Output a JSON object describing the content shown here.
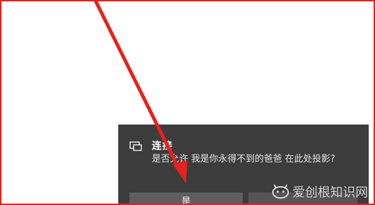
{
  "toast": {
    "title": "连接",
    "message": "是否允许 我是你永得不到的爸爸 在此处投影?",
    "icon": "project-screen-icon",
    "buttons": {
      "yes_label": "是",
      "no_label": ""
    },
    "background_color": "#3c3c3c"
  },
  "annotation": {
    "arrow_color": "#e8201e",
    "frame_color": "#e8201e"
  },
  "watermark": {
    "text": "爱创根知识网",
    "icon": "watermark-logo-icon"
  }
}
